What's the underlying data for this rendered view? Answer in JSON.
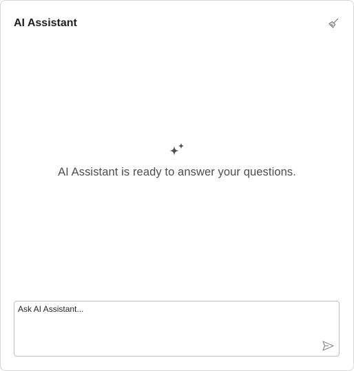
{
  "header": {
    "title": "AI Assistant",
    "clear_icon": "broom-icon"
  },
  "empty_state": {
    "icon": "sparkle-icon",
    "message": "AI Assistant is ready to answer your questions."
  },
  "input": {
    "placeholder": "Ask AI Assistant...",
    "value": "",
    "send_icon": "send-icon"
  },
  "colors": {
    "border": "#d6d6d6",
    "title": "#1f1f1f",
    "message": "#4d4d4d",
    "icon": "#6b6b6b",
    "send_icon": "#8a8a8a"
  }
}
